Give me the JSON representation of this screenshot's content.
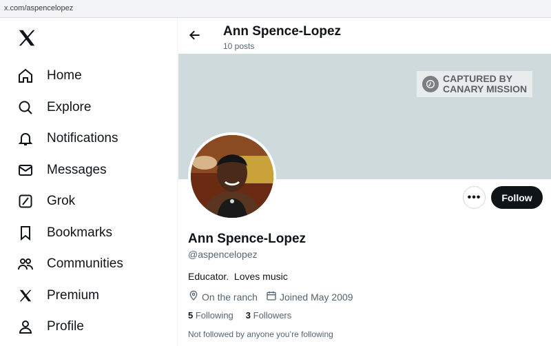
{
  "browser": {
    "url": "x.com/aspencelopez"
  },
  "sidebar": {
    "logo_icon": "x-logo-icon",
    "items": [
      {
        "label": "Home",
        "icon": "home-icon"
      },
      {
        "label": "Explore",
        "icon": "search-icon"
      },
      {
        "label": "Notifications",
        "icon": "bell-icon"
      },
      {
        "label": "Messages",
        "icon": "mail-icon"
      },
      {
        "label": "Grok",
        "icon": "grok-icon"
      },
      {
        "label": "Bookmarks",
        "icon": "bookmark-icon"
      },
      {
        "label": "Communities",
        "icon": "people-icon"
      },
      {
        "label": "Premium",
        "icon": "x-logo-icon"
      },
      {
        "label": "Profile",
        "icon": "person-icon"
      }
    ]
  },
  "header": {
    "name": "Ann Spence-Lopez",
    "posts": "10 posts"
  },
  "banner": {
    "watermark_line1": "CAPTURED BY",
    "watermark_line2": "CANARY MISSION",
    "color": "#cfdadc"
  },
  "profile": {
    "name": "Ann Spence-Lopez",
    "handle": "@aspencelopez",
    "bio": "Educator.  Loves music",
    "location": "On the ranch",
    "joined": "Joined May 2009",
    "following_count": "5",
    "following_label": "Following",
    "followers_count": "3",
    "followers_label": "Followers",
    "not_followed": "Not followed by anyone you’re following"
  },
  "actions": {
    "more_label": "•••",
    "follow_label": "Follow",
    "follow_bg": "#0f1419"
  }
}
